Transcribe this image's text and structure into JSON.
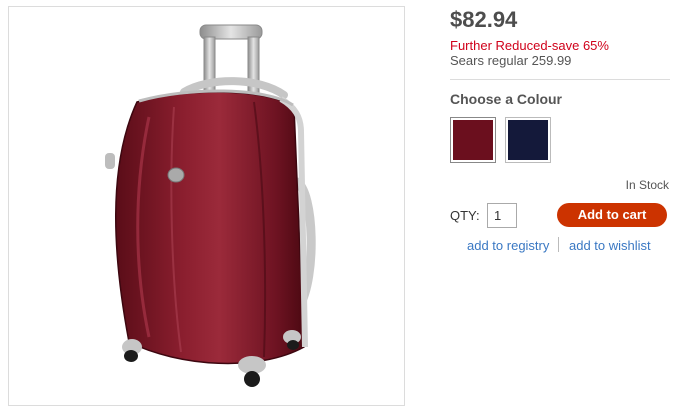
{
  "product": {
    "price": "$82.94",
    "reduced_text": "Further Reduced-save 65%",
    "regular_text": "Sears regular 259.99",
    "image_icon": "suitcase-product-image"
  },
  "colours": {
    "heading": "Choose a Colour",
    "options": [
      {
        "name": "burgundy",
        "hex": "#6b0f1e"
      },
      {
        "name": "navy",
        "hex": "#14193a"
      }
    ]
  },
  "stock": {
    "status": "In Stock"
  },
  "purchase": {
    "qty_label": "QTY:",
    "qty_value": "1",
    "add_to_cart": "Add to cart"
  },
  "links": {
    "registry": "add to registry",
    "wishlist": "add to wishlist"
  },
  "colors": {
    "accent": "#cc3300",
    "link": "#3a78c3",
    "sale_red": "#d0021b"
  }
}
